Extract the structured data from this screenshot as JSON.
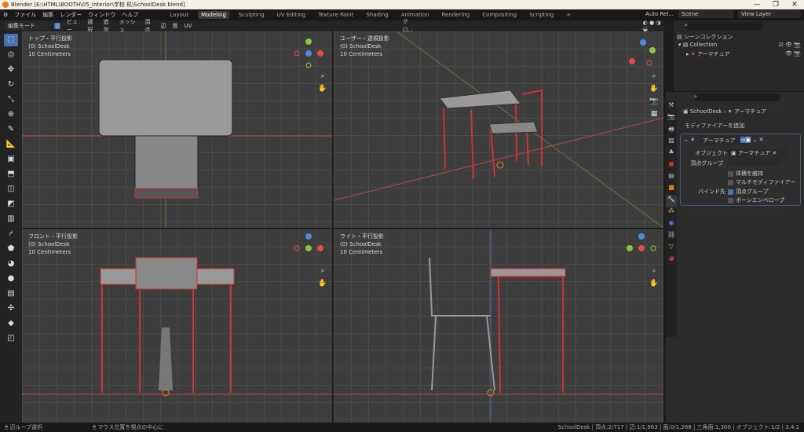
{
  "window": {
    "title": "Blender [E:\\HTML\\BOOTH\\05_Interior\\学校 机\\SchoolDesk.blend]",
    "min": "—",
    "max": "❐",
    "close": "✕"
  },
  "menu": [
    "ファイル",
    "編集",
    "レンダー",
    "ウィンドウ",
    "ヘルプ"
  ],
  "workspaces": [
    "Layout",
    "Modeling",
    "Sculpting",
    "UV Editing",
    "Texture Paint",
    "Shading",
    "Animation",
    "Rendering",
    "Compositing",
    "Scripting",
    "+"
  ],
  "header_right": {
    "auto": "Auto Rel...",
    "scene": "Scene",
    "view_layer": "View Layer"
  },
  "toolbar": {
    "mode": "編集モード",
    "items": [
      "ビュー",
      "選択",
      "追加",
      "メッシュ",
      "頂点",
      "辺",
      "面",
      "UV"
    ],
    "orientation": "グロ..."
  },
  "viewports": [
    {
      "title": "トップ・平行投影",
      "object": "(0) SchoolDesk",
      "scale": "10 Centimeters"
    },
    {
      "title": "ユーザー・透視投影",
      "object": "(0) SchoolDesk",
      "scale": "10 Centimeters"
    },
    {
      "title": "フロント・平行投影",
      "object": "(0) SchoolDesk",
      "scale": "10 Centimeters"
    },
    {
      "title": "ライト・平行投影",
      "object": "(0) SchoolDesk",
      "scale": "10 Centimeters"
    }
  ],
  "outliner": {
    "scene_collection": "シーンコレクション",
    "collection": "Collection",
    "item": "アーマチュア"
  },
  "properties": {
    "object": "SchoolDesk",
    "data": "アーマチュア",
    "add_modifier": "モディファイアーを追加",
    "modifier": {
      "name": "アーマチュア",
      "object_label": "オブジェクト",
      "object_value": "アーマチュア",
      "vgroup_label": "頂点グループ",
      "preserve_volume": "体積を維持",
      "multi_modifier": "マルチモディファイアー",
      "bind_label": "バインド先",
      "bind_vgroups": "頂点グループ",
      "bind_envelopes": "ボーンエンベロープ"
    }
  },
  "status": {
    "left": "辺ループ選択",
    "middle": "マウス位置を視点の中心に",
    "right": "SchoolDesk | 頂点:2/717 | 辺:1/1,963 | 面:0/1,268 | 三角面:1,300 | オブジェクト:1/2 | 3.4.1"
  },
  "colors": {
    "accent": "#4772b3",
    "select": "#e87d0d",
    "x": "#e64a4a",
    "y": "#8cc63f",
    "z": "#4a8ae6"
  }
}
